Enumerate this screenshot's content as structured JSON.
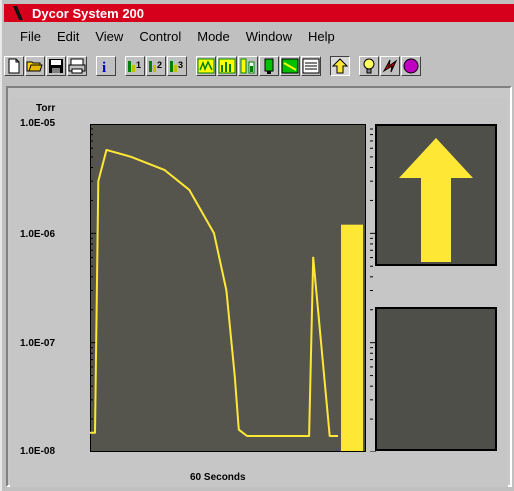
{
  "window": {
    "title": "Dycor System 200"
  },
  "menu": {
    "items": [
      "File",
      "Edit",
      "View",
      "Control",
      "Mode",
      "Window",
      "Help"
    ],
    "underline": [
      "F",
      "E",
      "V",
      "C",
      "M",
      "W",
      "H"
    ]
  },
  "toolbar": {
    "buttons": [
      "new-file-icon",
      "open-folder-icon",
      "save-disk-icon",
      "print-icon",
      "info-icon",
      "channel-1-icon",
      "channel-2-icon",
      "channel-3-icon",
      "analog-scan-icon",
      "bar-scan-icon",
      "leak-check-icon",
      "single-peak-icon",
      "trend-icon",
      "table-icon",
      "up-arrow-icon",
      "bulb-icon",
      "filament-icon",
      "stop-icon"
    ]
  },
  "chart": {
    "unit_label": "Torr",
    "y_ticks": [
      "1.0E-05",
      "1.0E-06",
      "1.0E-07",
      "1.0E-08"
    ],
    "x_label": "60 Seconds"
  },
  "chart_data": {
    "type": "line",
    "ylabel": "Torr",
    "xlabel": "60 Seconds",
    "yscale": "log",
    "ylim": [
      1e-08,
      1e-05
    ],
    "xlim": [
      0,
      60
    ],
    "grid": false,
    "series": [
      {
        "values": [
          [
            0,
            1.5e-08
          ],
          [
            1.2,
            1.5e-08
          ],
          [
            2.0,
            3e-06
          ],
          [
            4.0,
            5.8e-06
          ],
          [
            10,
            5e-06
          ],
          [
            18,
            3.8e-06
          ],
          [
            24,
            2.5e-06
          ],
          [
            30,
            1e-06
          ],
          [
            33,
            3e-07
          ],
          [
            35,
            5e-08
          ],
          [
            36,
            1.6e-08
          ],
          [
            38,
            1.4e-08
          ],
          [
            48,
            1.4e-08
          ],
          [
            53,
            1.4e-08
          ],
          [
            54,
            6e-07
          ],
          [
            58,
            1.4e-08
          ],
          [
            60,
            1.4e-08
          ]
        ]
      }
    ],
    "current_bar_value": 1.2e-06,
    "accent_color": "#ffe736",
    "plot_bg": "#55554e"
  },
  "indicator": {
    "top_icon": "rising-arrow-icon",
    "bottom_icon": "empty"
  },
  "colors": {
    "titlebar": "#d6001c",
    "trace": "#ffe736",
    "plot_bg": "#55554e"
  }
}
